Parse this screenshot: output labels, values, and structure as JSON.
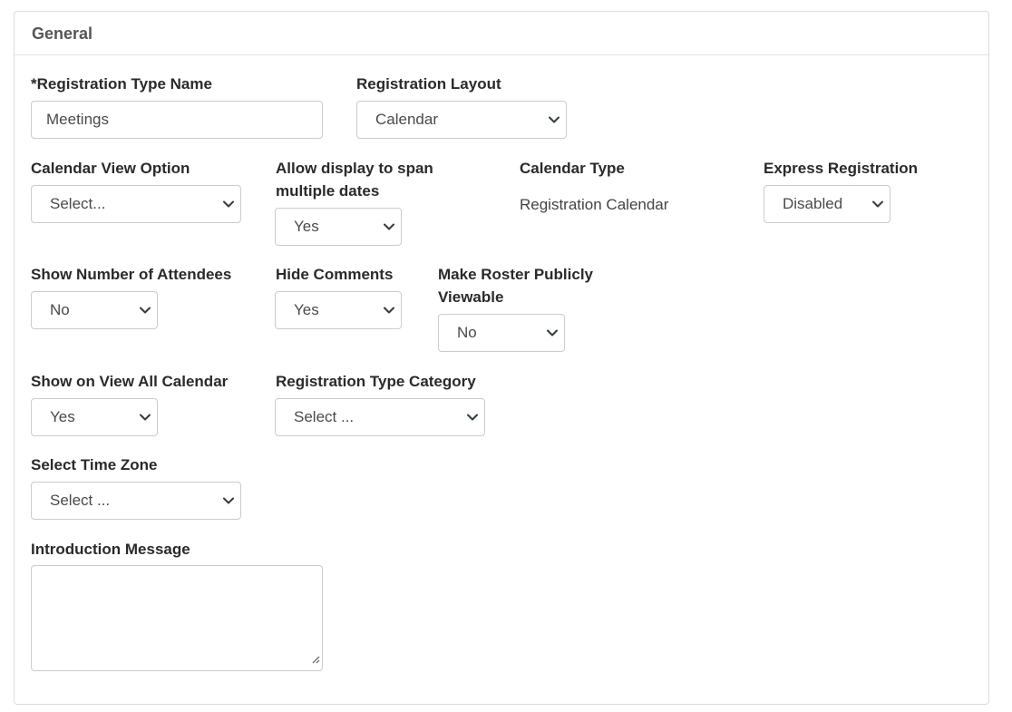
{
  "section": {
    "title": "General"
  },
  "fields": {
    "registration_type_name": {
      "label": "*Registration Type Name",
      "value": "Meetings"
    },
    "registration_layout": {
      "label": "Registration Layout",
      "value": "Calendar"
    },
    "calendar_view_option": {
      "label": "Calendar View Option",
      "value": "Select..."
    },
    "span_multiple_dates": {
      "label_line1": "Allow display to span",
      "label_line2": "multiple dates",
      "value": "Yes"
    },
    "calendar_type": {
      "label": "Calendar Type",
      "value": "Registration Calendar"
    },
    "express_registration": {
      "label": "Express Registration",
      "value": "Disabled"
    },
    "show_number_of_attendees": {
      "label": "Show Number of Attendees",
      "value": "No"
    },
    "hide_comments": {
      "label": "Hide Comments",
      "value": "Yes"
    },
    "roster_public": {
      "label_line1": "Make Roster Publicly",
      "label_line2": "Viewable",
      "value": "No"
    },
    "show_on_view_all_calendar": {
      "label": "Show on View All Calendar",
      "value": "Yes"
    },
    "registration_type_category": {
      "label": "Registration Type Category",
      "value": "Select ..."
    },
    "time_zone": {
      "label": "Select Time Zone",
      "value": "Select ..."
    },
    "introduction_message": {
      "label": "Introduction Message",
      "value": ""
    }
  },
  "icons": {
    "dropdown": "chevron-down-icon",
    "resize": "resize-grip-icon"
  }
}
